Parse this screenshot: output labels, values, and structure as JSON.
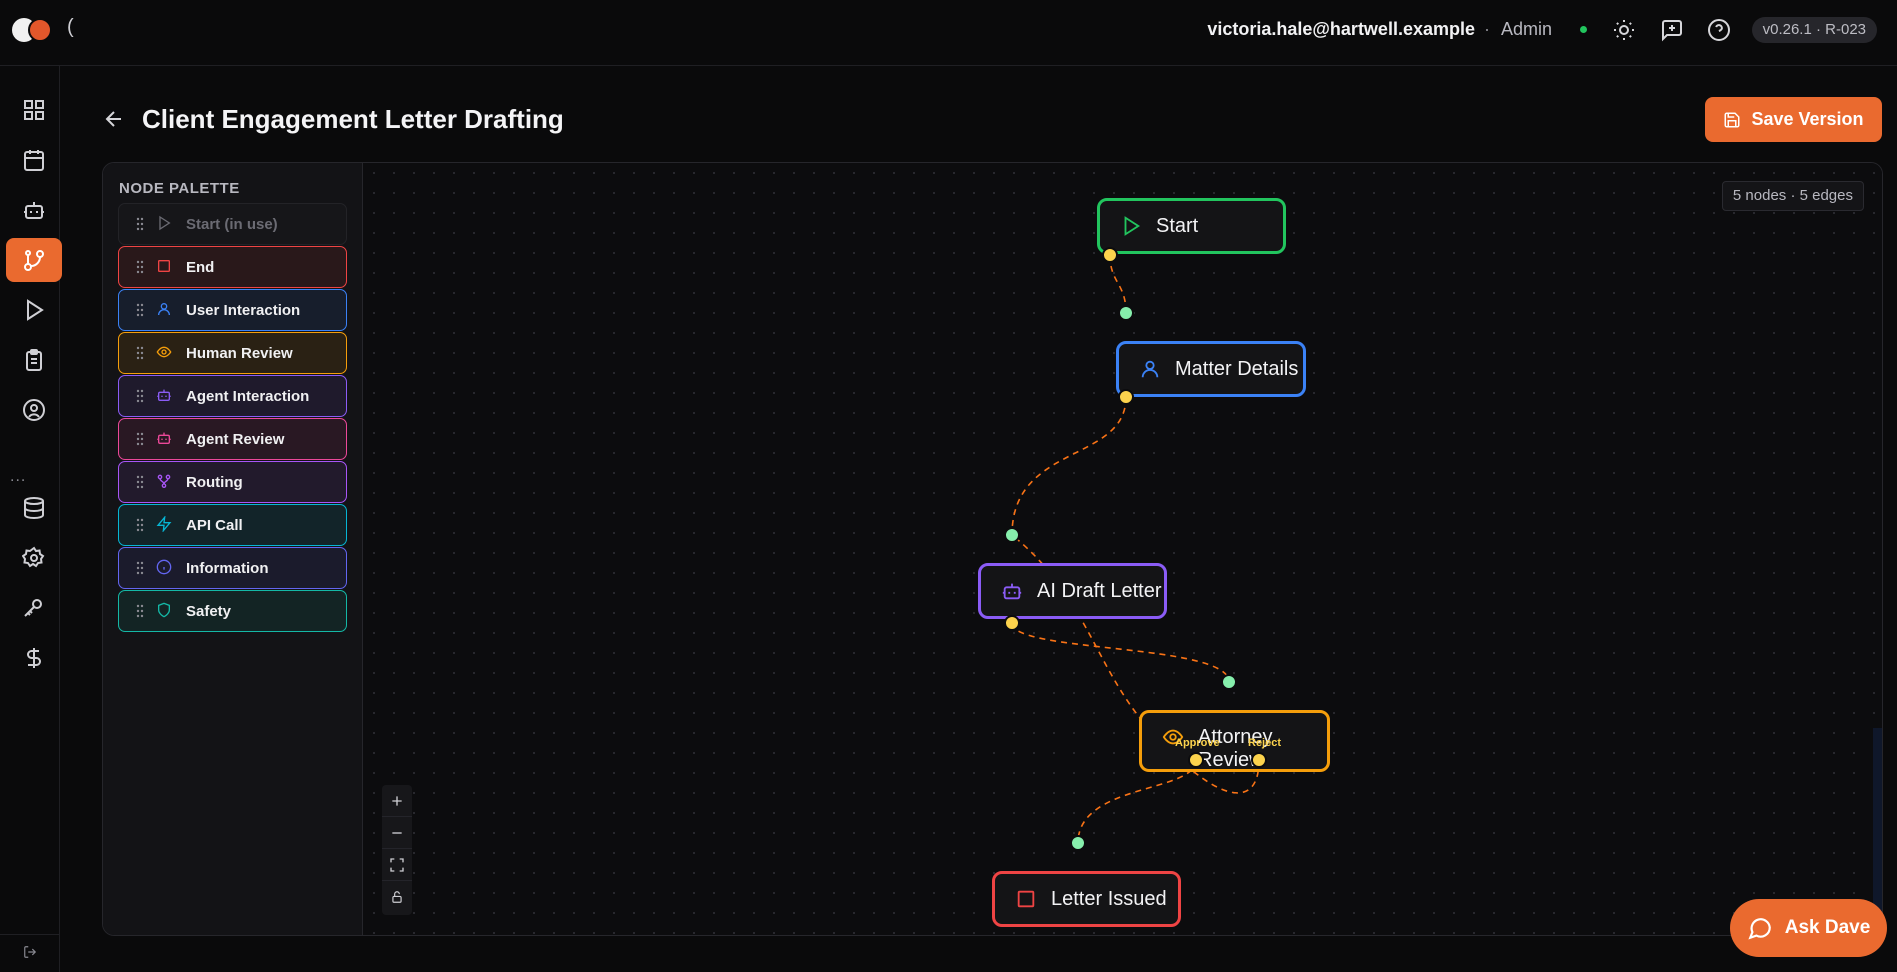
{
  "app": {
    "logo_icon": "app-logo",
    "breadcrumb_bracket": "("
  },
  "header": {
    "user_email": "victoria.hale@hartwell.example",
    "separator": "·",
    "user_role": "Admin",
    "status": "online",
    "icons": [
      "sun-icon",
      "message-plus-icon",
      "help-circle-icon"
    ],
    "version": "v0.26.1 · R-023"
  },
  "sidebar": {
    "items": [
      {
        "icon": "dashboard-icon"
      },
      {
        "icon": "calendar-icon"
      },
      {
        "icon": "bot-icon"
      },
      {
        "icon": "workflow-icon",
        "active": true
      },
      {
        "icon": "play-icon"
      },
      {
        "icon": "clipboard-list-icon"
      },
      {
        "icon": "user-circle-icon"
      },
      {
        "icon": "database-icon"
      },
      {
        "icon": "settings-icon"
      },
      {
        "icon": "key-icon"
      },
      {
        "icon": "dollar-icon"
      }
    ],
    "more_label": "...",
    "collapse_icon": "collapse-icon"
  },
  "page": {
    "title": "Client Engagement Letter Drafting",
    "save_label": "Save Version"
  },
  "palette": {
    "title": "NODE PALETTE",
    "items": [
      {
        "label": "Start (in use)",
        "color": "#6b6b73",
        "disabled": true,
        "icon": "play-icon"
      },
      {
        "label": "End",
        "color": "#ef4444",
        "icon": "square-icon"
      },
      {
        "label": "User Interaction",
        "color": "#3b82f6",
        "icon": "user-icon"
      },
      {
        "label": "Human Review",
        "color": "#f59e0b",
        "icon": "eye-icon"
      },
      {
        "label": "Agent Interaction",
        "color": "#8b5cf6",
        "icon": "bot-icon"
      },
      {
        "label": "Agent Review",
        "color": "#ec4899",
        "icon": "bot-icon"
      },
      {
        "label": "Routing",
        "color": "#a855f7",
        "icon": "routing-icon"
      },
      {
        "label": "API Call",
        "color": "#06b6d4",
        "icon": "zap-icon"
      },
      {
        "label": "Information",
        "color": "#6366f1",
        "icon": "info-icon"
      },
      {
        "label": "Safety",
        "color": "#14b8a6",
        "icon": "shield-icon"
      }
    ]
  },
  "canvas": {
    "counts": "5 nodes · 5 edges",
    "nodes": {
      "start": {
        "label": "Start",
        "color": "#22c55e"
      },
      "matter": {
        "label": "Matter Details",
        "color": "#3b82f6"
      },
      "draft": {
        "label": "AI Draft Letter",
        "color": "#8b5cf6"
      },
      "review": {
        "label": "Attorney Review",
        "color": "#f59e0b",
        "approve_label": "Approve",
        "reject_label": "Reject"
      },
      "issued": {
        "label": "Letter Issued",
        "color": "#ef4444"
      }
    },
    "edge_color": "#f97316"
  },
  "ask": {
    "label": "Ask Dave"
  }
}
